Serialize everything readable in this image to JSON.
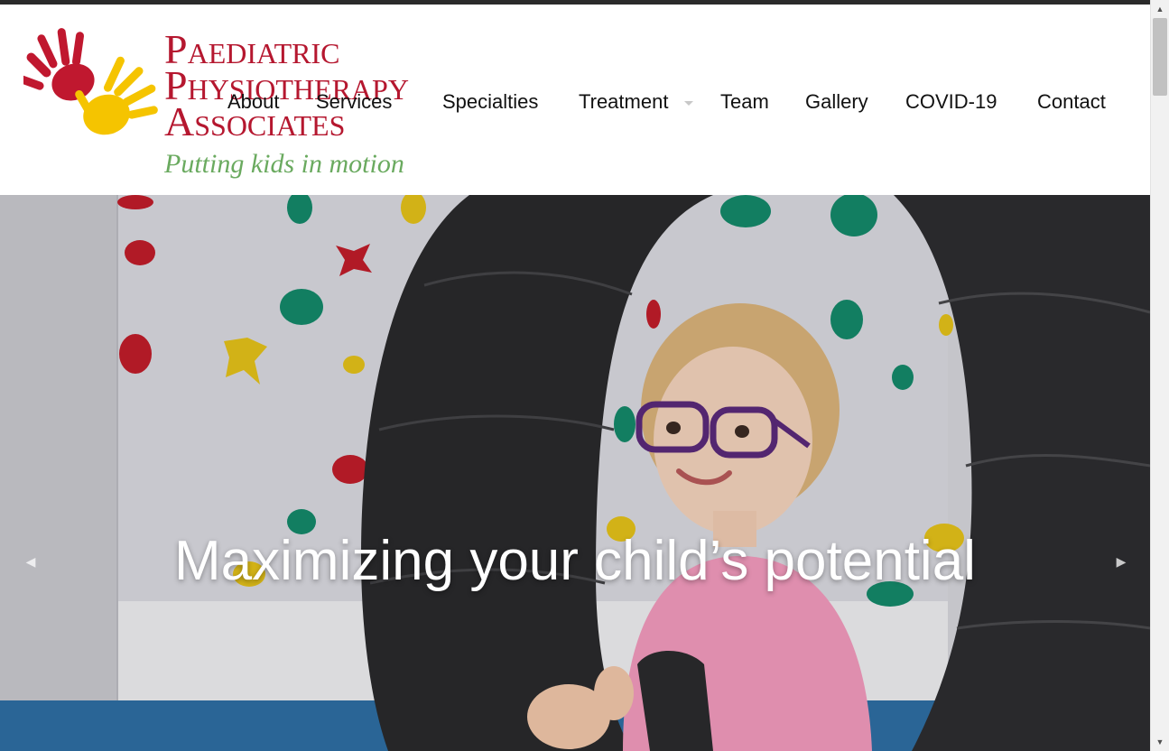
{
  "logo": {
    "line1": "Paediatric",
    "line2": "Physiotherapy",
    "line3": "Associates",
    "tagline": "Putting kids in motion",
    "hand_colors": [
      "#c0182f",
      "#f5c400"
    ]
  },
  "nav": {
    "items": [
      {
        "label": "About"
      },
      {
        "label": "Services"
      },
      {
        "label": "Specialties"
      },
      {
        "label": "Treatment",
        "has_dropdown": true
      },
      {
        "label": "Team"
      },
      {
        "label": "Gallery"
      },
      {
        "label": "COVID-19"
      },
      {
        "label": "Contact"
      }
    ]
  },
  "hero": {
    "caption": "Maximizing your child’s potential",
    "prev_icon": "chevron-left-icon",
    "next_icon": "chevron-right-icon"
  },
  "colors": {
    "brand_red": "#b5172f",
    "tagline_green": "#6aaa5f",
    "nav_text": "#111111"
  }
}
